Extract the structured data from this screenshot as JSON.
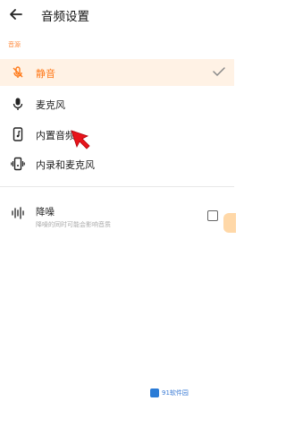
{
  "header": {
    "title": "音频设置"
  },
  "audio_source": {
    "section_label": "音源",
    "options": [
      {
        "label": "静音",
        "icon": "mic-off-icon",
        "selected": true
      },
      {
        "label": "麦克风",
        "icon": "mic-icon",
        "selected": false
      },
      {
        "label": "内置音频",
        "icon": "phone-audio-icon",
        "selected": false
      },
      {
        "label": "内录和麦克风",
        "icon": "phone-vibrate-icon",
        "selected": false
      }
    ]
  },
  "noise_reduction": {
    "title": "降噪",
    "description": "降噪的同时可能会影响音质",
    "checked": false
  },
  "watermark": {
    "text": "91软件园"
  },
  "colors": {
    "accent": "#ff7a1a",
    "selected_bg": "#fff2e5",
    "cursor": "#e8141b"
  }
}
